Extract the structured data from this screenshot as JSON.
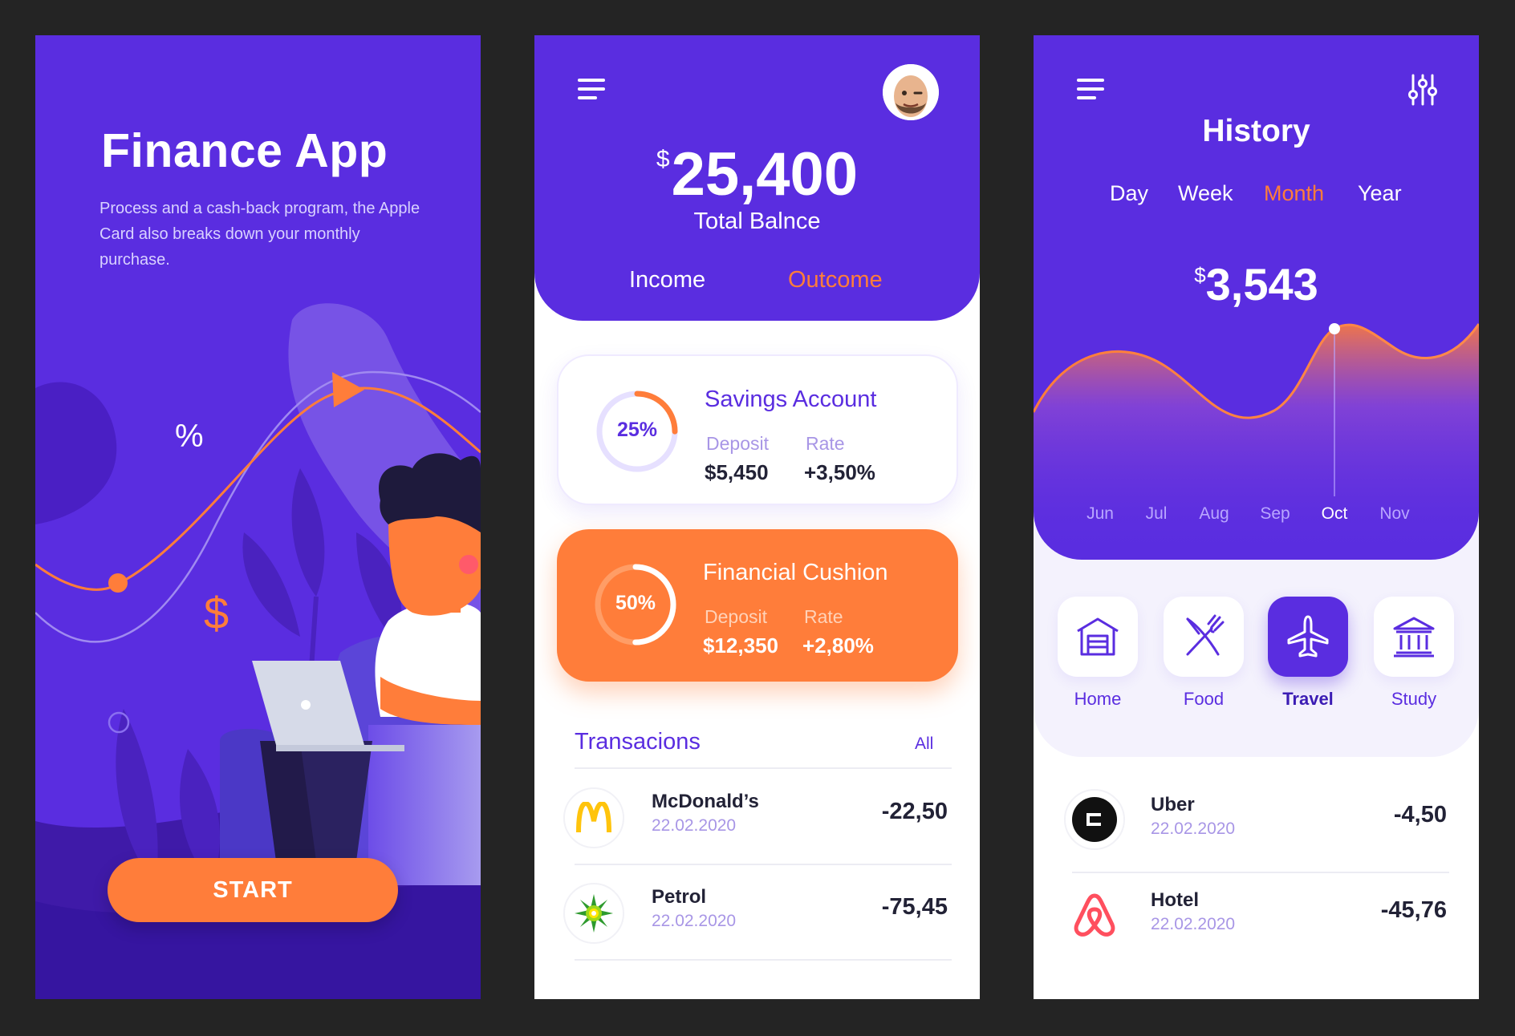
{
  "colors": {
    "primary": "#5a2de0",
    "accent": "#ff7d3a",
    "muted": "#a896e6"
  },
  "onboarding": {
    "title": "Finance App",
    "description": "Process and a cash-back program, the Apple Card also breaks down your monthly purchase.",
    "percent_symbol": "%",
    "dollar_symbol": "$",
    "start_label": "START"
  },
  "dashboard": {
    "balance_currency": "$",
    "balance_amount": "25,400",
    "balance_label": "Total Balnce",
    "tabs": [
      {
        "label": "Income",
        "active": false
      },
      {
        "label": "Outcome",
        "active": true
      }
    ],
    "cards": [
      {
        "title": "Savings Account",
        "percent": "25%",
        "progress": 0.25,
        "deposit_label": "Deposit",
        "deposit_value": "$5,450",
        "rate_label": "Rate",
        "rate_value": "+3,50%"
      },
      {
        "title": "Financial Cushion",
        "percent": "50%",
        "progress": 0.5,
        "deposit_label": "Deposit",
        "deposit_value": "$12,350",
        "rate_label": "Rate",
        "rate_value": "+2,80%"
      }
    ],
    "transactions_title": "Transacions",
    "transactions_all": "All",
    "transactions": [
      {
        "name": "McDonald’s",
        "date": "22.02.2020",
        "amount": "-22,50",
        "logo": "mcdonalds-logo"
      },
      {
        "name": "Petrol",
        "date": "22.02.2020",
        "amount": "-75,45",
        "logo": "bp-logo"
      }
    ]
  },
  "history": {
    "title": "History",
    "periods": [
      {
        "label": "Day",
        "active": false
      },
      {
        "label": "Week",
        "active": false
      },
      {
        "label": "Month",
        "active": true
      },
      {
        "label": "Year",
        "active": false
      }
    ],
    "value_currency": "$",
    "value_amount": "3,543",
    "months": [
      "Jun",
      "Jul",
      "Aug",
      "Sep",
      "Oct",
      "Nov"
    ],
    "selected_month": "Oct",
    "categories": [
      {
        "label": "Home",
        "icon": "garage-home-icon",
        "active": false
      },
      {
        "label": "Food",
        "icon": "fork-knife-icon",
        "active": false
      },
      {
        "label": "Travel",
        "icon": "airplane-icon",
        "active": true
      },
      {
        "label": "Study",
        "icon": "bank-building-icon",
        "active": false
      }
    ],
    "transactions": [
      {
        "name": "Uber",
        "date": "22.02.2020",
        "amount": "-4,50",
        "logo": "uber-logo"
      },
      {
        "name": "Hotel",
        "date": "22.02.2020",
        "amount": "-45,76",
        "logo": "airbnb-logo"
      }
    ]
  }
}
